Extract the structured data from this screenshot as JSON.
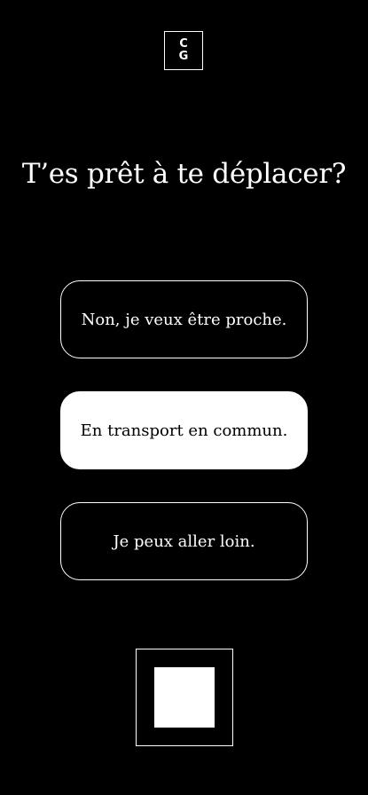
{
  "logo": {
    "line1": "C",
    "line2": "G"
  },
  "question": {
    "text": "T’es prêt à te déplacer?"
  },
  "options": [
    {
      "label": "Non, je veux être proche.",
      "selected": false
    },
    {
      "label": "En transport en commun.",
      "selected": true
    },
    {
      "label": "Je peux aller loin.",
      "selected": false
    }
  ],
  "submit": {
    "icon": "square-icon"
  },
  "colors": {
    "background": "#000000",
    "foreground": "#ffffff"
  }
}
